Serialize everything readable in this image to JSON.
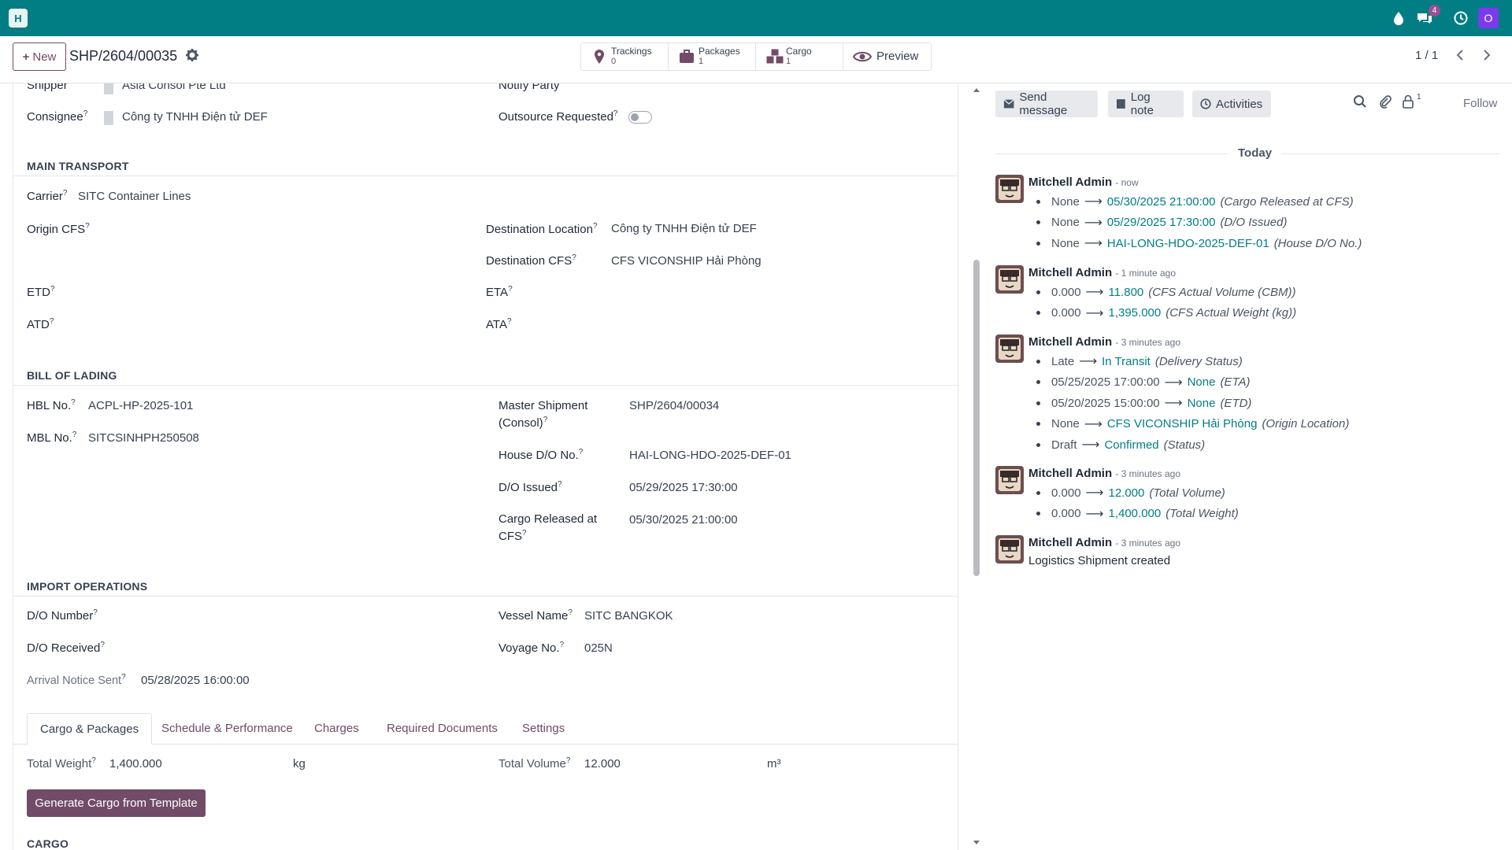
{
  "navbar": {
    "app_initial": "H",
    "chat_count": "4",
    "user_initial": "O"
  },
  "control": {
    "new_label": "New",
    "record_name": "SHP/2604/00035",
    "smart_buttons": [
      {
        "label": "Trackings",
        "value": "0"
      },
      {
        "label": "Packages",
        "value": "1"
      },
      {
        "label": "Cargo",
        "value": "1"
      },
      {
        "label": "Preview",
        "value": ""
      }
    ],
    "pager": "1 / 1"
  },
  "form": {
    "shipper_label": "Shipper",
    "shipper_value": "Asia Consol Pte Ltd",
    "notify_label": "Notify Party",
    "consignee_label": "Consignee",
    "consignee_value": "Công ty TNHH Điện tử DEF",
    "outsource_label": "Outsource Requested",
    "main_transport": {
      "title": "MAIN TRANSPORT",
      "carrier_label": "Carrier",
      "carrier_value": "SITC Container Lines",
      "origin_cfs_label": "Origin CFS",
      "dest_location_label": "Destination Location",
      "dest_location_value": "Công ty TNHH Điện tử DEF",
      "dest_cfs_label": "Destination CFS",
      "dest_cfs_value": "CFS VICONSHIP Hải Phòng",
      "etd_label": "ETD",
      "eta_label": "ETA",
      "atd_label": "ATD",
      "ata_label": "ATA"
    },
    "bill_of_lading": {
      "title": "BILL OF LADING",
      "hbl_label": "HBL No.",
      "hbl_value": "ACPL-HP-2025-101",
      "mbl_label": "MBL No.",
      "mbl_value": "SITCSINHPH250508",
      "master_label_1": "Master Shipment",
      "master_label_2": "(Consol)",
      "master_value": "SHP/2604/00034",
      "house_do_label": "House D/O No.",
      "house_do_value": "HAI-LONG-HDO-2025-DEF-01",
      "do_issued_label": "D/O Issued",
      "do_issued_value": "05/29/2025 17:30:00",
      "cargo_released_label_1": "Cargo Released at",
      "cargo_released_label_2": "CFS",
      "cargo_released_value": "05/30/2025 21:00:00"
    },
    "import_ops": {
      "title": "IMPORT OPERATIONS",
      "do_number_label": "D/O Number",
      "vessel_label": "Vessel Name",
      "vessel_value": "SITC BANGKOK",
      "do_received_label": "D/O Received",
      "voyage_label": "Voyage No.",
      "voyage_value": "025N",
      "arrival_label": "Arrival Notice Sent",
      "arrival_value": "05/28/2025 16:00:00"
    },
    "tabs": [
      "Cargo & Packages",
      "Schedule & Performance",
      "Charges",
      "Required Documents",
      "Settings"
    ],
    "cargo_tab": {
      "total_weight_label": "Total Weight",
      "total_weight_value": "1,400.000",
      "weight_unit": "kg",
      "total_volume_label": "Total Volume",
      "total_volume_value": "12.000",
      "volume_unit": "m³",
      "generate_button": "Generate Cargo from Template",
      "cargo_title": "CARGO"
    }
  },
  "chatter": {
    "send_message": "Send message",
    "log_note": "Log note",
    "activities": "Activities",
    "followers_count": "1",
    "follow": "Follow",
    "today": "Today",
    "messages": [
      {
        "author": "Mitchell Admin",
        "time": "- now",
        "tracks": [
          {
            "old": "None",
            "new": "05/30/2025 21:00:00",
            "field": "(Cargo Released at CFS)"
          },
          {
            "old": "None",
            "new": "05/29/2025 17:30:00",
            "field": "(D/O Issued)"
          },
          {
            "old": "None",
            "new": "HAI-LONG-HDO-2025-DEF-01",
            "field": "(House D/O No.)"
          }
        ]
      },
      {
        "author": "Mitchell Admin",
        "time": "- 1 minute ago",
        "tracks": [
          {
            "old": "0.000",
            "new": "11.800",
            "field": "(CFS Actual Volume (CBM))"
          },
          {
            "old": "0.000",
            "new": "1,395.000",
            "field": "(CFS Actual Weight (kg))"
          }
        ]
      },
      {
        "author": "Mitchell Admin",
        "time": "- 3 minutes ago",
        "tracks": [
          {
            "old": "Late",
            "new": "In Transit",
            "field": "(Delivery Status)"
          },
          {
            "old": "05/25/2025 17:00:00",
            "new": "None",
            "field": "(ETA)"
          },
          {
            "old": "05/20/2025 15:00:00",
            "new": "None",
            "field": "(ETD)"
          },
          {
            "old": "None",
            "new": "CFS VICONSHIP Hải Phòng",
            "field": "(Origin Location)"
          },
          {
            "old": "Draft",
            "new": "Confirmed",
            "field": "(Status)"
          }
        ]
      },
      {
        "author": "Mitchell Admin",
        "time": "- 3 minutes ago",
        "tracks": [
          {
            "old": "0.000",
            "new": "12.000",
            "field": "(Total Volume)"
          },
          {
            "old": "0.000",
            "new": "1,400.000",
            "field": "(Total Weight)"
          }
        ]
      },
      {
        "author": "Mitchell Admin",
        "time": "- 3 minutes ago",
        "body": "Logistics Shipment created"
      }
    ]
  }
}
